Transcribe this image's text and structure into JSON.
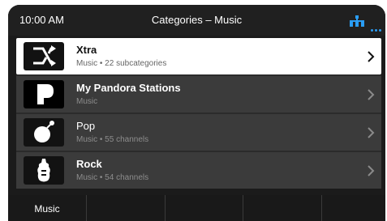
{
  "status": {
    "time": "10:00 AM",
    "title": "Categories – Music",
    "icons": [
      "connection-icon",
      "more-dots-icon"
    ],
    "accent_color": "#2a9df4"
  },
  "list": {
    "items": [
      {
        "title": "Xtra",
        "subtitle": "Music • 22 subcategories",
        "icon": "shuffle-arrows-icon",
        "selected": true
      },
      {
        "title": "My Pandora Stations",
        "subtitle": "Music",
        "icon": "pandora-logo-icon",
        "selected": false
      },
      {
        "title": "Pop",
        "subtitle": "Music • 55 channels",
        "icon": "pop-bomb-icon",
        "selected": false
      },
      {
        "title": "Rock",
        "subtitle": "Music • 54 channels",
        "icon": "electric-guitar-icon",
        "selected": false
      }
    ]
  },
  "tabbar": {
    "tabs": [
      {
        "label": "Music"
      },
      {
        "label": ""
      },
      {
        "label": ""
      },
      {
        "label": ""
      },
      {
        "label": ""
      }
    ]
  }
}
